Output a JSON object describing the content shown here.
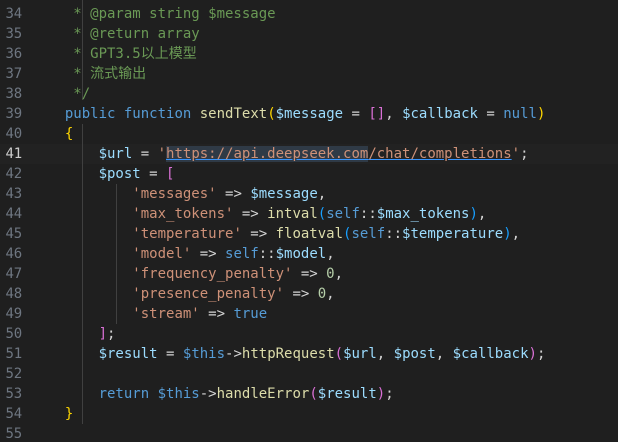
{
  "theme": {
    "background": "#1f1f1f",
    "line_number": "#6e7681",
    "line_number_active": "#cccccc",
    "comment": "#6a9955",
    "keyword": "#569cd6",
    "function": "#dcdcaa",
    "variable": "#9cdcfe",
    "string": "#ce9178",
    "number": "#b5cea8",
    "bracket_1": "#ffd700",
    "bracket_2": "#da70d6",
    "bracket_3": "#179fff"
  },
  "editor": {
    "active_line": 41,
    "lines": [
      {
        "n": "34",
        "tokens": [
          {
            "t": "   * @param string $message",
            "c": "c-comment"
          }
        ]
      },
      {
        "n": "35",
        "tokens": [
          {
            "t": "   * @return array",
            "c": "c-comment"
          }
        ]
      },
      {
        "n": "36",
        "tokens": [
          {
            "t": "   * GPT3.5以上模型",
            "c": "c-comment"
          }
        ]
      },
      {
        "n": "37",
        "tokens": [
          {
            "t": "   * 流式输出",
            "c": "c-comment"
          }
        ]
      },
      {
        "n": "38",
        "tokens": [
          {
            "t": "   */",
            "c": "c-comment"
          }
        ]
      },
      {
        "n": "39",
        "tokens": [
          {
            "t": "  ",
            "c": "c-op"
          },
          {
            "t": "public",
            "c": "c-keyword"
          },
          {
            "t": " ",
            "c": "c-op"
          },
          {
            "t": "function",
            "c": "c-keyword"
          },
          {
            "t": " ",
            "c": "c-op"
          },
          {
            "t": "sendText",
            "c": "c-func"
          },
          {
            "t": "(",
            "c": "c-bracket1"
          },
          {
            "t": "$message",
            "c": "c-var"
          },
          {
            "t": " = ",
            "c": "c-op"
          },
          {
            "t": "[]",
            "c": "c-bracket2"
          },
          {
            "t": ", ",
            "c": "c-op"
          },
          {
            "t": "$callback",
            "c": "c-var"
          },
          {
            "t": " = ",
            "c": "c-op"
          },
          {
            "t": "null",
            "c": "c-keyword"
          },
          {
            "t": ")",
            "c": "c-bracket1"
          }
        ]
      },
      {
        "n": "40",
        "tokens": [
          {
            "t": "  ",
            "c": "c-op"
          },
          {
            "t": "{",
            "c": "c-bracket1"
          }
        ]
      },
      {
        "n": "41",
        "tokens": [
          {
            "t": "      ",
            "c": "c-op"
          },
          {
            "t": "$url",
            "c": "c-var"
          },
          {
            "t": " = ",
            "c": "c-op"
          },
          {
            "t": "'",
            "c": "c-string"
          },
          {
            "t": "https://api.deepseek.com",
            "c": "c-string url-highlight"
          },
          {
            "t": "/chat/completions",
            "c": "c-string url-highlight-tail"
          },
          {
            "t": "'",
            "c": "c-string"
          },
          {
            "t": ";",
            "c": "c-op"
          }
        ]
      },
      {
        "n": "42",
        "tokens": [
          {
            "t": "      ",
            "c": "c-op"
          },
          {
            "t": "$post",
            "c": "c-var"
          },
          {
            "t": " = ",
            "c": "c-op"
          },
          {
            "t": "[",
            "c": "c-bracket2"
          }
        ]
      },
      {
        "n": "43",
        "tokens": [
          {
            "t": "          ",
            "c": "c-op"
          },
          {
            "t": "'messages'",
            "c": "c-string"
          },
          {
            "t": " => ",
            "c": "c-op"
          },
          {
            "t": "$message",
            "c": "c-var"
          },
          {
            "t": ",",
            "c": "c-op"
          }
        ]
      },
      {
        "n": "44",
        "tokens": [
          {
            "t": "          ",
            "c": "c-op"
          },
          {
            "t": "'max_tokens'",
            "c": "c-string"
          },
          {
            "t": " => ",
            "c": "c-op"
          },
          {
            "t": "intval",
            "c": "c-func"
          },
          {
            "t": "(",
            "c": "c-bracket3"
          },
          {
            "t": "self",
            "c": "c-keyword"
          },
          {
            "t": "::",
            "c": "c-op"
          },
          {
            "t": "$max_tokens",
            "c": "c-var"
          },
          {
            "t": ")",
            "c": "c-bracket3"
          },
          {
            "t": ",",
            "c": "c-op"
          }
        ]
      },
      {
        "n": "45",
        "tokens": [
          {
            "t": "          ",
            "c": "c-op"
          },
          {
            "t": "'temperature'",
            "c": "c-string"
          },
          {
            "t": " => ",
            "c": "c-op"
          },
          {
            "t": "floatval",
            "c": "c-func"
          },
          {
            "t": "(",
            "c": "c-bracket3"
          },
          {
            "t": "self",
            "c": "c-keyword"
          },
          {
            "t": "::",
            "c": "c-op"
          },
          {
            "t": "$temperature",
            "c": "c-var"
          },
          {
            "t": ")",
            "c": "c-bracket3"
          },
          {
            "t": ",",
            "c": "c-op"
          }
        ]
      },
      {
        "n": "46",
        "tokens": [
          {
            "t": "          ",
            "c": "c-op"
          },
          {
            "t": "'model'",
            "c": "c-string"
          },
          {
            "t": " => ",
            "c": "c-op"
          },
          {
            "t": "self",
            "c": "c-keyword"
          },
          {
            "t": "::",
            "c": "c-op"
          },
          {
            "t": "$model",
            "c": "c-var"
          },
          {
            "t": ",",
            "c": "c-op"
          }
        ]
      },
      {
        "n": "47",
        "tokens": [
          {
            "t": "          ",
            "c": "c-op"
          },
          {
            "t": "'frequency_penalty'",
            "c": "c-string"
          },
          {
            "t": " => ",
            "c": "c-op"
          },
          {
            "t": "0",
            "c": "c-number"
          },
          {
            "t": ",",
            "c": "c-op"
          }
        ]
      },
      {
        "n": "48",
        "tokens": [
          {
            "t": "          ",
            "c": "c-op"
          },
          {
            "t": "'presence_penalty'",
            "c": "c-string"
          },
          {
            "t": " => ",
            "c": "c-op"
          },
          {
            "t": "0",
            "c": "c-number"
          },
          {
            "t": ",",
            "c": "c-op"
          }
        ]
      },
      {
        "n": "49",
        "tokens": [
          {
            "t": "          ",
            "c": "c-op"
          },
          {
            "t": "'stream'",
            "c": "c-string"
          },
          {
            "t": " => ",
            "c": "c-op"
          },
          {
            "t": "true",
            "c": "c-keyword"
          }
        ]
      },
      {
        "n": "50",
        "tokens": [
          {
            "t": "      ",
            "c": "c-op"
          },
          {
            "t": "]",
            "c": "c-bracket2"
          },
          {
            "t": ";",
            "c": "c-op"
          }
        ]
      },
      {
        "n": "51",
        "tokens": [
          {
            "t": "      ",
            "c": "c-op"
          },
          {
            "t": "$result",
            "c": "c-var"
          },
          {
            "t": " = ",
            "c": "c-op"
          },
          {
            "t": "$this",
            "c": "c-keyword"
          },
          {
            "t": "->",
            "c": "c-op"
          },
          {
            "t": "httpRequest",
            "c": "c-func"
          },
          {
            "t": "(",
            "c": "c-bracket2"
          },
          {
            "t": "$url",
            "c": "c-var"
          },
          {
            "t": ", ",
            "c": "c-op"
          },
          {
            "t": "$post",
            "c": "c-var"
          },
          {
            "t": ", ",
            "c": "c-op"
          },
          {
            "t": "$callback",
            "c": "c-var"
          },
          {
            "t": ")",
            "c": "c-bracket2"
          },
          {
            "t": ";",
            "c": "c-op"
          }
        ]
      },
      {
        "n": "52",
        "tokens": []
      },
      {
        "n": "53",
        "tokens": [
          {
            "t": "      ",
            "c": "c-op"
          },
          {
            "t": "return",
            "c": "c-keyword"
          },
          {
            "t": " ",
            "c": "c-op"
          },
          {
            "t": "$this",
            "c": "c-keyword"
          },
          {
            "t": "->",
            "c": "c-op"
          },
          {
            "t": "handleError",
            "c": "c-func"
          },
          {
            "t": "(",
            "c": "c-bracket2"
          },
          {
            "t": "$result",
            "c": "c-var"
          },
          {
            "t": ")",
            "c": "c-bracket2"
          },
          {
            "t": ";",
            "c": "c-op"
          }
        ]
      },
      {
        "n": "54",
        "tokens": [
          {
            "t": "  ",
            "c": "c-op"
          },
          {
            "t": "}",
            "c": "c-bracket1"
          }
        ]
      },
      {
        "n": "55",
        "tokens": []
      }
    ]
  }
}
